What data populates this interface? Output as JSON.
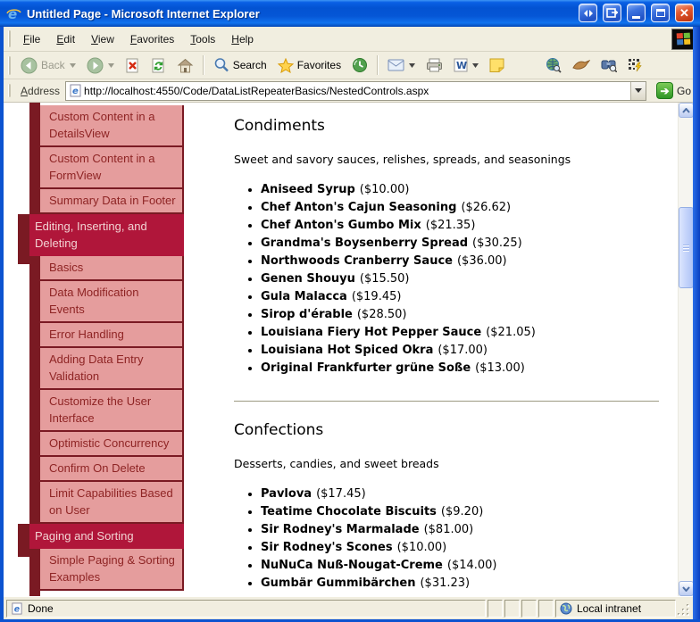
{
  "window": {
    "title": "Untitled Page - Microsoft Internet Explorer"
  },
  "menu": {
    "items": [
      "File",
      "Edit",
      "View",
      "Favorites",
      "Tools",
      "Help"
    ]
  },
  "toolbar": {
    "back": "Back",
    "search": "Search",
    "favorites": "Favorites"
  },
  "address": {
    "label": "Address",
    "url": "http://localhost:4550/Code/DataListRepeaterBasics/NestedControls.aspx",
    "go": "Go"
  },
  "sidebar": {
    "items": [
      {
        "label": "Custom Content in a DetailsView",
        "type": "sub"
      },
      {
        "label": "Custom Content in a FormView",
        "type": "sub"
      },
      {
        "label": "Summary Data in Footer",
        "type": "sub"
      },
      {
        "label": "Editing, Inserting, and Deleting",
        "type": "header"
      },
      {
        "label": "Basics",
        "type": "sub"
      },
      {
        "label": "Data Modification Events",
        "type": "sub"
      },
      {
        "label": "Error Handling",
        "type": "sub"
      },
      {
        "label": "Adding Data Entry Validation",
        "type": "sub"
      },
      {
        "label": "Customize the User Interface",
        "type": "sub"
      },
      {
        "label": "Optimistic Concurrency",
        "type": "sub"
      },
      {
        "label": "Confirm On Delete",
        "type": "sub"
      },
      {
        "label": "Limit Capabilities Based on User",
        "type": "sub"
      },
      {
        "label": "Paging and Sorting",
        "type": "header"
      },
      {
        "label": "Simple Paging & Sorting Examples",
        "type": "sub"
      }
    ]
  },
  "content": {
    "sections": [
      {
        "title": "Condiments",
        "description": "Sweet and savory sauces, relishes, spreads, and seasonings",
        "products": [
          {
            "name": "Aniseed Syrup",
            "price": "($10.00)"
          },
          {
            "name": "Chef Anton's Cajun Seasoning",
            "price": "($26.62)"
          },
          {
            "name": "Chef Anton's Gumbo Mix",
            "price": "($21.35)"
          },
          {
            "name": "Grandma's Boysenberry Spread",
            "price": "($30.25)"
          },
          {
            "name": "Northwoods Cranberry Sauce",
            "price": "($36.00)"
          },
          {
            "name": "Genen Shouyu",
            "price": "($15.50)"
          },
          {
            "name": "Gula Malacca",
            "price": "($19.45)"
          },
          {
            "name": "Sirop d'érable",
            "price": "($28.50)"
          },
          {
            "name": "Louisiana Fiery Hot Pepper Sauce",
            "price": "($21.05)"
          },
          {
            "name": "Louisiana Hot Spiced Okra",
            "price": "($17.00)"
          },
          {
            "name": "Original Frankfurter grüne Soße",
            "price": "($13.00)"
          }
        ]
      },
      {
        "title": "Confections",
        "description": "Desserts, candies, and sweet breads",
        "products": [
          {
            "name": "Pavlova",
            "price": "($17.45)"
          },
          {
            "name": "Teatime Chocolate Biscuits",
            "price": "($9.20)"
          },
          {
            "name": "Sir Rodney's Marmalade",
            "price": "($81.00)"
          },
          {
            "name": "Sir Rodney's Scones",
            "price": "($10.00)"
          },
          {
            "name": "NuNuCa Nuß-Nougat-Creme",
            "price": "($14.00)"
          },
          {
            "name": "Gumbär Gummibärchen",
            "price": "($31.23)"
          }
        ]
      }
    ]
  },
  "status": {
    "text": "Done",
    "zone": "Local intranet"
  },
  "colors": {
    "titlebar_blue": "#0353D2",
    "window_border_blue": "#0C53D0",
    "chrome_beige": "#F1EEE0",
    "sidebar_header_bg": "#B0163A",
    "sidebar_item_bg": "#E59D9D",
    "sidebar_strip": "#7A1A23",
    "sidebar_item_text": "#8E2424",
    "sidebar_header_text": "#F2D3D3",
    "go_button_green": "#2F9626",
    "rule_color": "#9C9A82"
  }
}
